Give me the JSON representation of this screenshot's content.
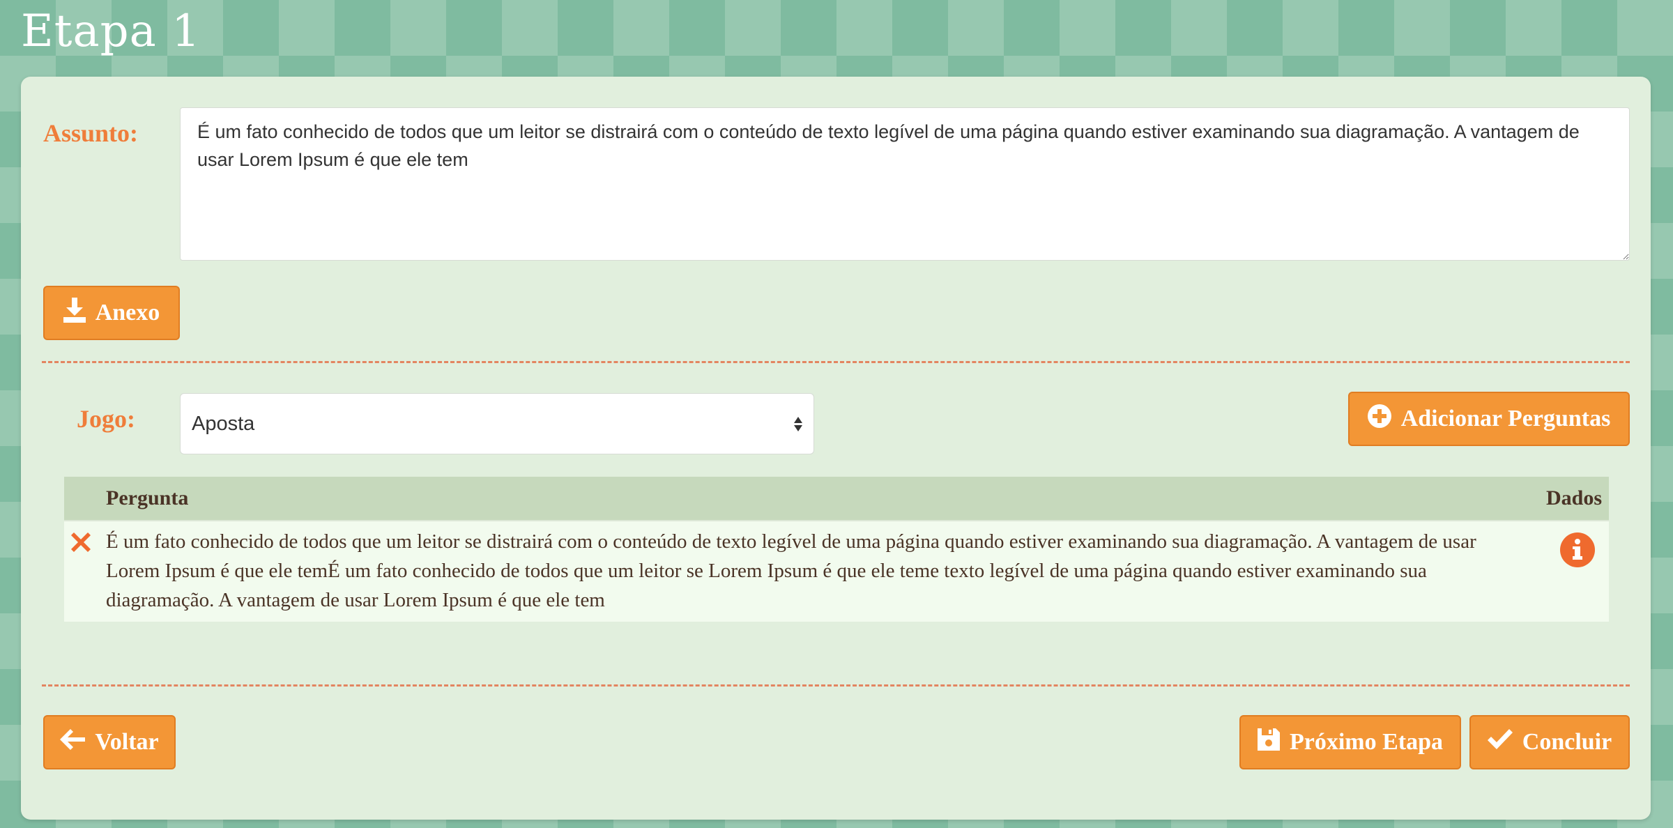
{
  "page": {
    "title": "Etapa 1"
  },
  "subject": {
    "label": "Assunto:",
    "value": "É um fato conhecido de todos que um leitor se distrairá com o conteúdo de texto legível de uma página quando estiver examinando sua diagramação. A vantagem de usar Lorem Ipsum é que ele tem"
  },
  "attach_button": {
    "label": "Anexo",
    "icon": "download-icon"
  },
  "game": {
    "label": "Jogo:",
    "selected": "Aposta"
  },
  "add_questions_button": {
    "label": "Adicionar Perguntas",
    "icon": "plus-circle-icon"
  },
  "table": {
    "headers": {
      "question": "Pergunta",
      "data": "Dados"
    },
    "rows": [
      {
        "question": "É um fato conhecido de todos que um leitor se distrairá com o conteúdo de texto legível de uma página quando estiver examinando sua diagramação. A vantagem de usar Lorem Ipsum é que ele temÉ um fato conhecido de todos que um leitor se Lorem Ipsum é que ele teme texto legível de uma página quando estiver examinando sua diagramação. A vantagem de usar Lorem Ipsum é que ele tem",
        "delete_icon": "close-icon",
        "info_icon": "info-icon"
      }
    ]
  },
  "footer": {
    "back_label": "Voltar",
    "next_label": "Próximo Etapa",
    "finish_label": "Concluir"
  },
  "colors": {
    "accent": "#f39636",
    "label": "#ef7d3a",
    "panel": "#e1efdd",
    "table_header": "#c6d9bc",
    "delete": "#ef6a2e",
    "info": "#ef6a2e"
  }
}
